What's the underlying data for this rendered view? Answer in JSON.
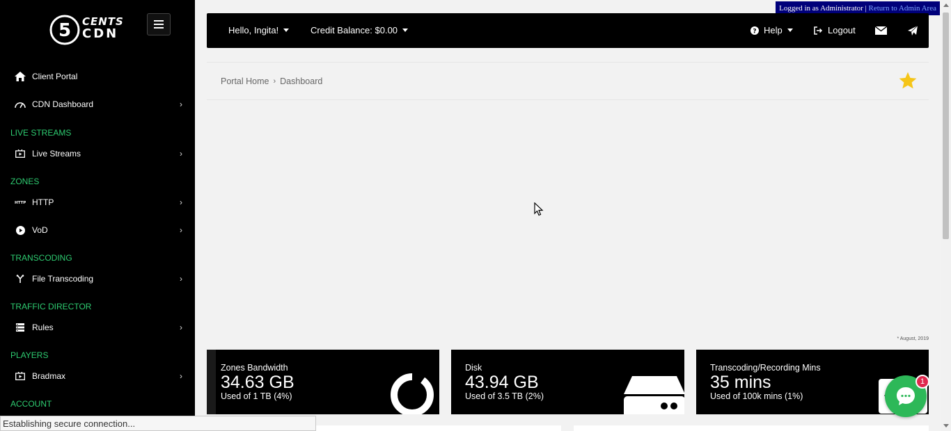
{
  "brand": {
    "line1": "CENTS",
    "line2": "CDN",
    "digit": "5"
  },
  "admin_bar": {
    "text": "Logged in as Administrator",
    "sep": " | ",
    "link": "Return to Admin Area"
  },
  "sidebar": {
    "items": [
      {
        "label": "Client Portal"
      },
      {
        "label": "CDN Dashboard"
      },
      {
        "label": "Live Streams"
      },
      {
        "label": "HTTP"
      },
      {
        "label": "VoD"
      },
      {
        "label": "File Transcoding"
      },
      {
        "label": "Rules"
      },
      {
        "label": "Bradmax"
      }
    ],
    "sections": [
      "LIVE STREAMS",
      "ZONES",
      "TRANSCODING",
      "TRAFFIC DIRECTOR",
      "PLAYERS",
      "ACCOUNT"
    ]
  },
  "topbar": {
    "greeting": "Hello, Ingita!",
    "credit": "Credit Balance: $0.00",
    "help": "Help",
    "logout": "Logout"
  },
  "breadcrumb": {
    "home": "Portal Home",
    "current": "Dashboard"
  },
  "footnote": "* August, 2019",
  "cards": [
    {
      "title": "Zones Bandwidth",
      "value": "34.63 GB",
      "sub": "Used of 1 TB (4%)"
    },
    {
      "title": "Disk",
      "value": "43.94 GB",
      "sub": "Used of 3.5 TB (2%)"
    },
    {
      "title": "Transcoding/Recording Mins",
      "value": "35 mins",
      "sub": "Used of 100k mins (1%)"
    }
  ],
  "chat": {
    "badge": "1"
  },
  "status": "Establishing secure connection...",
  "colors": {
    "accent": "#2ecc71",
    "star": "#f5c518",
    "chat": "#2db858",
    "badge": "#e0284e"
  }
}
